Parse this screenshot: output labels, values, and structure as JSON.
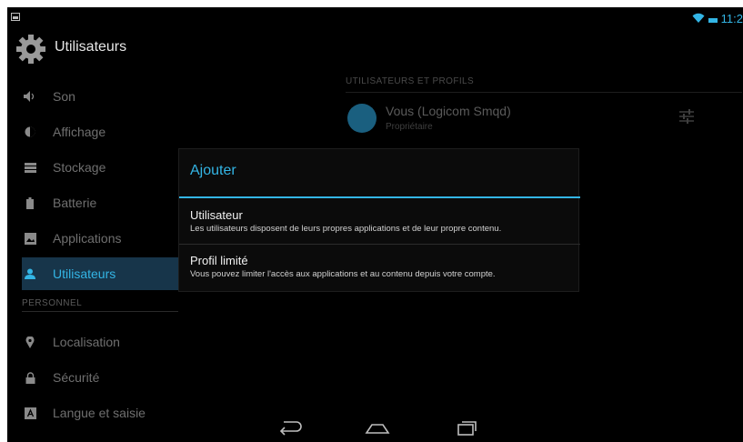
{
  "status_bar": {
    "time": "11:2",
    "icons": [
      "notification-image-icon",
      "wifi-icon",
      "battery-icon"
    ],
    "accent_color": "#33b5e5"
  },
  "action_bar": {
    "title": "Utilisateurs",
    "icon": "settings-gear-icon"
  },
  "sidebar": {
    "items": [
      {
        "label": "Son",
        "icon": "volume-icon"
      },
      {
        "label": "Affichage",
        "icon": "brightness-icon"
      },
      {
        "label": "Stockage",
        "icon": "storage-icon"
      },
      {
        "label": "Batterie",
        "icon": "battery-icon"
      },
      {
        "label": "Applications",
        "icon": "apps-icon"
      },
      {
        "label": "Utilisateurs",
        "icon": "user-icon",
        "selected": true
      }
    ],
    "section_personnel": "PERSONNEL",
    "personal_items": [
      {
        "label": "Localisation",
        "icon": "location-pin-icon"
      },
      {
        "label": "Sécurité",
        "icon": "lock-icon"
      },
      {
        "label": "Langue et saisie",
        "icon": "keyboard-icon"
      }
    ],
    "selected_color": "#33b5e5"
  },
  "main": {
    "header": "UTILISATEURS ET PROFILS",
    "user": {
      "name": "Vous (Logicom Smqd)",
      "role": "Propriétaire"
    }
  },
  "dialog": {
    "title": "Ajouter",
    "options": [
      {
        "title": "Utilisateur",
        "subtitle": "Les utilisateurs disposent de leurs propres applications et de leur propre contenu."
      },
      {
        "title": "Profil limité",
        "subtitle": "Vous pouvez limiter l'accès aux applications et au contenu depuis votre compte."
      }
    ]
  },
  "nav_bar": {
    "buttons": [
      "back-icon",
      "home-icon",
      "recent-apps-icon"
    ]
  }
}
